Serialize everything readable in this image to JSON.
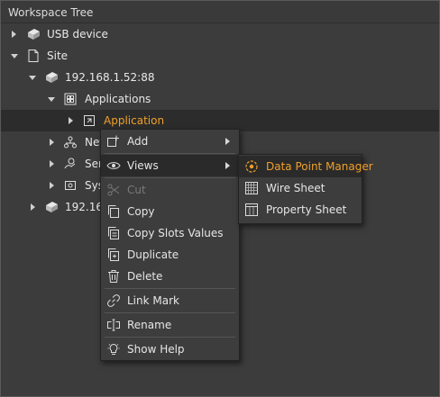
{
  "panel": {
    "title": "Workspace Tree"
  },
  "tree": [
    {
      "label": "USB device"
    },
    {
      "label": "Site"
    },
    {
      "label": "192.168.1.52:88"
    },
    {
      "label": "Applications"
    },
    {
      "label": "Application"
    },
    {
      "label": "Net"
    },
    {
      "label": "Ser"
    },
    {
      "label": "Sys"
    },
    {
      "label": "192.16"
    }
  ],
  "context_menu": {
    "items": [
      {
        "label": "Add"
      },
      {
        "label": "Views"
      },
      {
        "label": "Cut"
      },
      {
        "label": "Copy"
      },
      {
        "label": "Copy Slots Values"
      },
      {
        "label": "Duplicate"
      },
      {
        "label": "Delete"
      },
      {
        "label": "Link Mark"
      },
      {
        "label": "Rename"
      },
      {
        "label": "Show Help"
      }
    ]
  },
  "views_submenu": {
    "items": [
      {
        "label": "Data Point Manager"
      },
      {
        "label": "Wire Sheet"
      },
      {
        "label": "Property Sheet"
      }
    ]
  },
  "colors": {
    "accent": "#f0a028",
    "background": "#3c3c3c",
    "highlight": "#2a2a2a"
  }
}
